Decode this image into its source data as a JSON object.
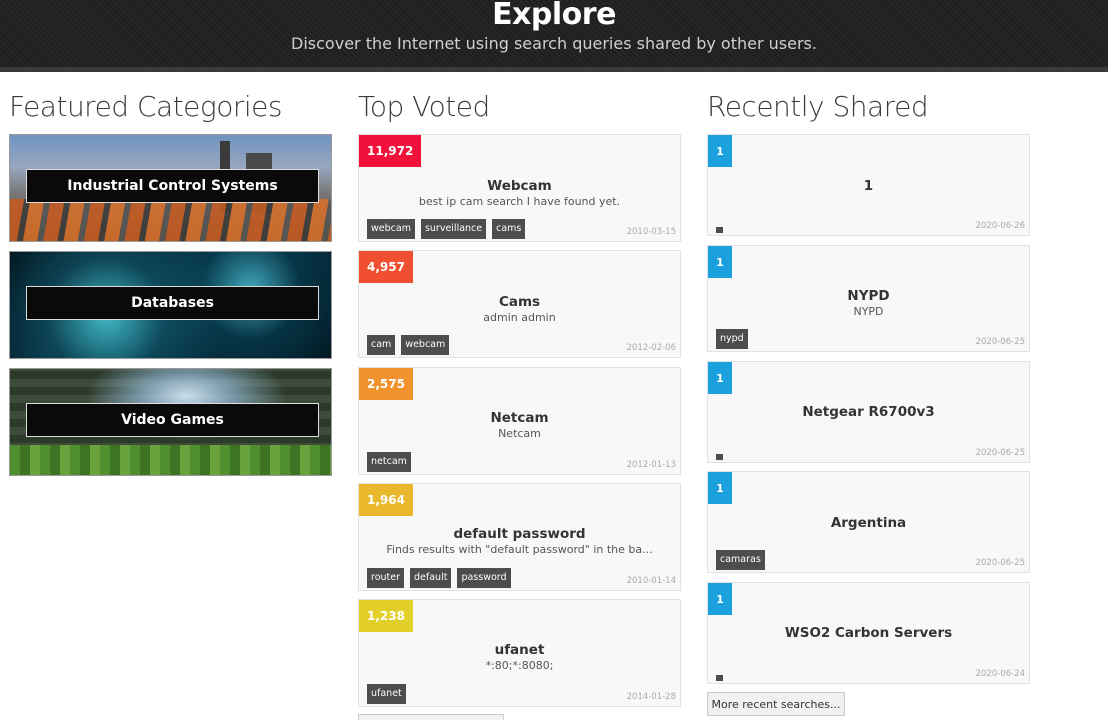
{
  "header": {
    "title": "Explore",
    "subtitle": "Discover the Internet using search queries shared by other users."
  },
  "featured": {
    "heading": "Featured Categories",
    "items": [
      {
        "label": "Industrial Control Systems"
      },
      {
        "label": "Databases"
      },
      {
        "label": "Video Games"
      }
    ]
  },
  "top_voted": {
    "heading": "Top Voted",
    "items": [
      {
        "votes": "11,972",
        "color": "#f0123a",
        "title": "Webcam",
        "desc": "best ip cam search I have found yet.",
        "tags": [
          "webcam",
          "surveillance",
          "cams"
        ],
        "date": "2010-03-15"
      },
      {
        "votes": "4,957",
        "color": "#f05030",
        "title": "Cams",
        "desc": "admin admin",
        "tags": [
          "cam",
          "webcam"
        ],
        "date": "2012-02-06"
      },
      {
        "votes": "2,575",
        "color": "#f0922e",
        "title": "Netcam",
        "desc": "Netcam",
        "tags": [
          "netcam"
        ],
        "date": "2012-01-13"
      },
      {
        "votes": "1,964",
        "color": "#e9b82c",
        "title": "default password",
        "desc": "Finds results with \"default password\" in the ba...",
        "tags": [
          "router",
          "default",
          "password"
        ],
        "date": "2010-01-14"
      },
      {
        "votes": "1,238",
        "color": "#e3cf2a",
        "title": "ufanet",
        "desc": "*:80;*:8080;",
        "tags": [
          "ufanet"
        ],
        "date": "2014-01-28"
      }
    ]
  },
  "recent": {
    "heading": "Recently Shared",
    "items": [
      {
        "votes": "1",
        "title": "1",
        "desc": "",
        "tags": [],
        "date": "2020-06-26"
      },
      {
        "votes": "1",
        "title": "NYPD",
        "desc": "NYPD",
        "tags": [
          "nypd"
        ],
        "date": "2020-06-25"
      },
      {
        "votes": "1",
        "title": "Netgear R6700v3",
        "desc": "",
        "tags": [],
        "date": "2020-06-25"
      },
      {
        "votes": "1",
        "title": "Argentina",
        "desc": "",
        "tags": [
          "camaras"
        ],
        "date": "2020-06-25"
      },
      {
        "votes": "1",
        "title": "WSO2 Carbon Servers",
        "desc": "",
        "tags": [],
        "date": "2020-06-24"
      }
    ],
    "more_label": "More recent searches..."
  }
}
